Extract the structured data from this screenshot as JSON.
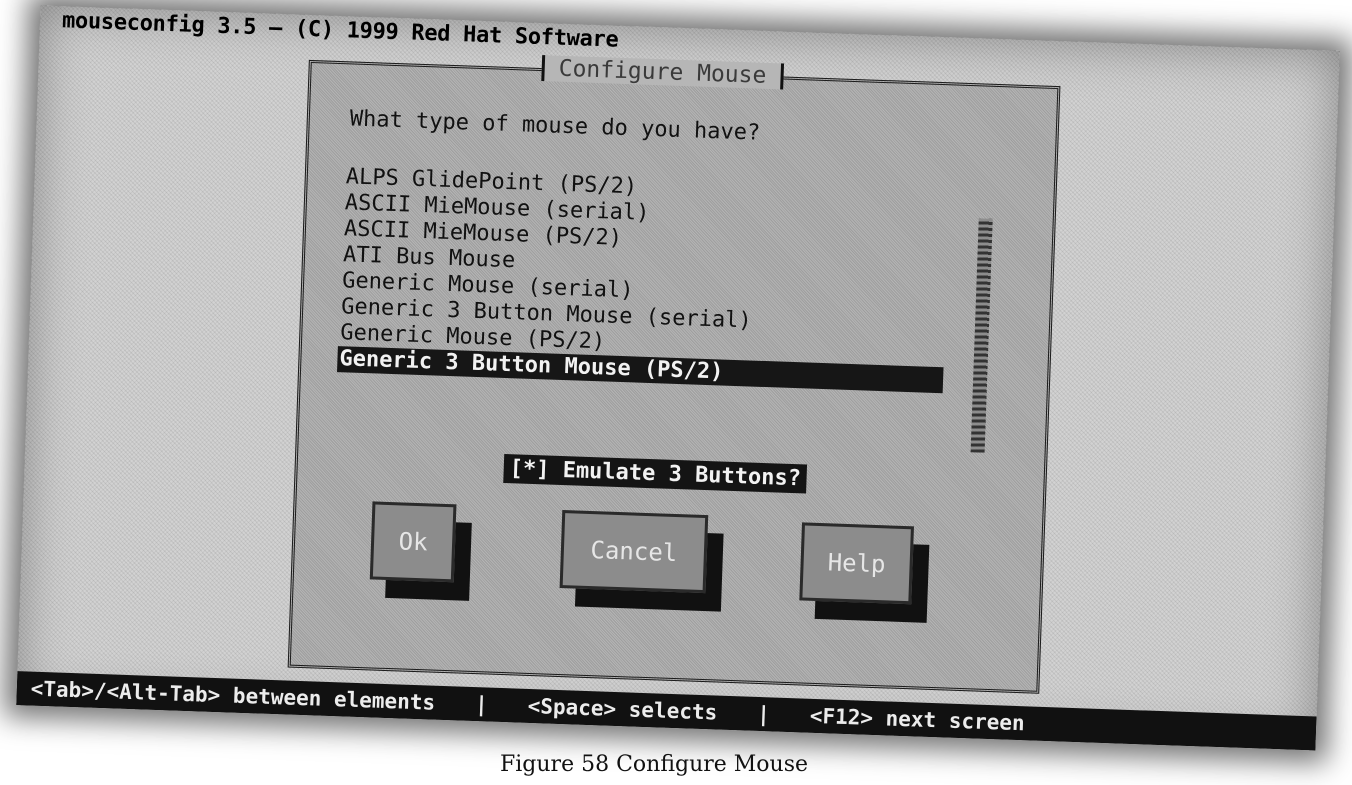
{
  "app_title": "mouseconfig 3.5 — (C) 1999 Red Hat Software",
  "dialog": {
    "title": "Configure Mouse",
    "prompt": "What type of mouse do you have?",
    "mouse_types": [
      "ALPS GlidePoint (PS/2)",
      "ASCII MieMouse (serial)",
      "ASCII MieMouse (PS/2)",
      "ATI Bus Mouse",
      "Generic Mouse (serial)",
      "Generic 3 Button Mouse (serial)",
      "Generic Mouse (PS/2)",
      "Generic 3 Button Mouse (PS/2)"
    ],
    "selected_index": 7,
    "emulate_checkbox": "[*] Emulate 3 Buttons?",
    "buttons": {
      "ok": "Ok",
      "cancel": "Cancel",
      "help": "Help"
    }
  },
  "hints": {
    "tab": "<Tab>/<Alt-Tab> between elements",
    "separator": "|",
    "space": "<Space> selects",
    "f12": "<F12> next screen"
  },
  "caption": "Figure 58 Configure Mouse"
}
